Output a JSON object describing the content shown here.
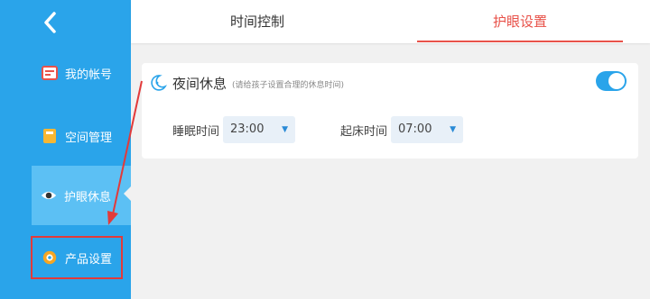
{
  "sidebar": {
    "back_icon": "chevron-left-icon",
    "items": [
      {
        "label": "我的帐号",
        "icon": "account-card-icon"
      },
      {
        "label": "空间管理",
        "icon": "space-folder-icon"
      },
      {
        "label": "护眼休息",
        "icon": "eye-icon"
      },
      {
        "label": "产品设置",
        "icon": "settings-gear-icon"
      }
    ]
  },
  "tabs": [
    {
      "label": "时间控制"
    },
    {
      "label": "护眼设置"
    }
  ],
  "night_rest": {
    "title": "夜间休息",
    "hint": "(请给孩子设置合理的休息时间)",
    "toggle_on": true,
    "sleep_label": "睡眠时间",
    "sleep_value": "23:00",
    "wake_label": "起床时间",
    "wake_value": "07:00"
  },
  "colors": {
    "sidebar": "#2aa4ea",
    "active_tab": "#e8524a",
    "annotation": "#e23a3a"
  }
}
